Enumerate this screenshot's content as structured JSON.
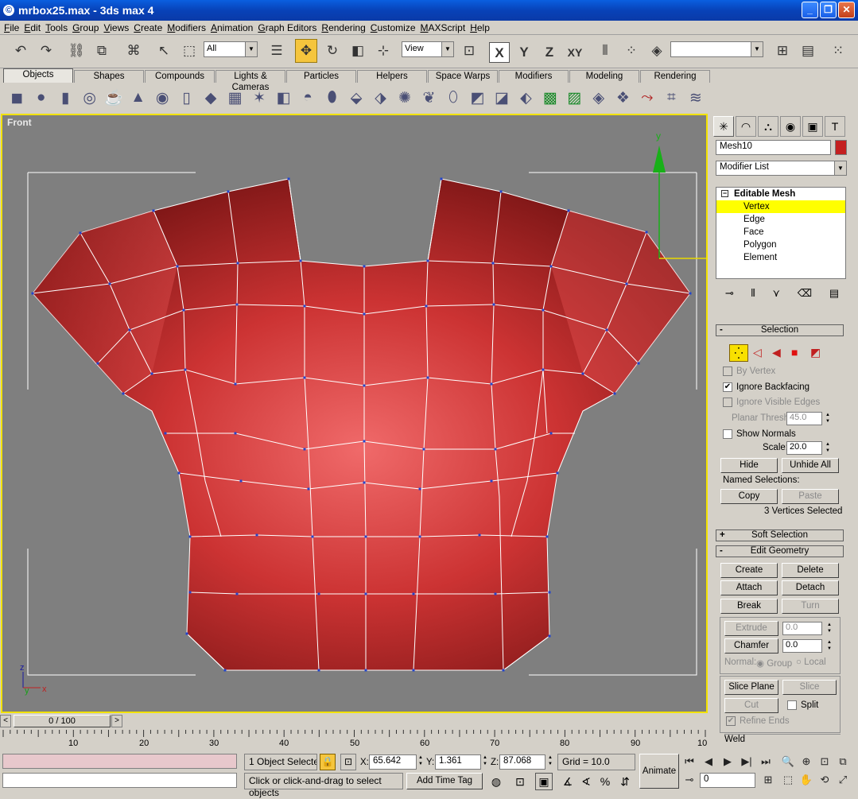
{
  "window": {
    "title": "mrbox25.max - 3ds max 4",
    "controls": [
      "_",
      "❐",
      "✕"
    ]
  },
  "menu": [
    "File",
    "Edit",
    "Tools",
    "Group",
    "Views",
    "Create",
    "Modifiers",
    "Animation",
    "Graph Editors",
    "Rendering",
    "Customize",
    "MAXScript",
    "Help"
  ],
  "toolbar": {
    "selection_filter": "All",
    "ref_coord": "View",
    "named_selection": "",
    "axes": [
      "X",
      "Y",
      "Z",
      "XY"
    ]
  },
  "tabs": [
    "Objects",
    "Shapes",
    "Compounds",
    "Lights & Cameras",
    "Particles",
    "Helpers",
    "Space Warps",
    "Modifiers",
    "Modeling",
    "Rendering"
  ],
  "viewport": {
    "label": "Front",
    "axis_y": "y",
    "tripod": {
      "z": "z",
      "y": "y",
      "x": "x"
    },
    "mesh_color": "#c42a2a",
    "wire_color": "#ffffff"
  },
  "command_panel": {
    "object_name": "Mesh10",
    "object_color": "#c42020",
    "modifier_list": "Modifier List",
    "stack": {
      "root": "Editable Mesh",
      "items": [
        "Vertex",
        "Edge",
        "Face",
        "Polygon",
        "Element"
      ],
      "selected": "Vertex"
    },
    "selection": {
      "title": "Selection",
      "by_vertex": "By Vertex",
      "ignore_backfacing": "Ignore Backfacing",
      "ignore_visible_edges": "Ignore Visible Edges",
      "planar_thresh_label": "Planar Thresh:",
      "planar_thresh": "45.0",
      "show_normals": "Show Normals",
      "scale_label": "Scale:",
      "scale": "20.0",
      "hide": "Hide",
      "unhide_all": "Unhide All",
      "named_selections": "Named Selections:",
      "copy": "Copy",
      "paste": "Paste",
      "status": "3 Vertices Selected"
    },
    "soft_selection": "Soft Selection",
    "edit_geometry": {
      "title": "Edit Geometry",
      "create": "Create",
      "delete": "Delete",
      "attach": "Attach",
      "detach": "Detach",
      "break": "Break",
      "turn": "Turn",
      "extrude": "Extrude",
      "extrude_val": "0.0",
      "chamfer": "Chamfer",
      "chamfer_val": "0.0",
      "normal_label": "Normal:",
      "group": "Group",
      "local": "Local",
      "slice_plane": "Slice Plane",
      "slice": "Slice",
      "cut": "Cut",
      "split": "Split",
      "refine_ends": "Refine Ends",
      "weld": "Weld"
    }
  },
  "timeline": {
    "frame": "0 / 100",
    "ticks": [
      "10",
      "20",
      "30",
      "40",
      "50",
      "60",
      "70",
      "80",
      "90",
      "10"
    ]
  },
  "status": {
    "objects_selected": "1 Object Selecte",
    "x_label": "X:",
    "x": "65.642",
    "y_label": "Y:",
    "y": "1.361",
    "z_label": "Z:",
    "z": "87.068",
    "grid": "Grid = 10.0",
    "prompt": "Click or click-and-drag to select objects",
    "add_time_tag": "Add Time Tag",
    "animate": "Animate",
    "frame_field": "0"
  }
}
